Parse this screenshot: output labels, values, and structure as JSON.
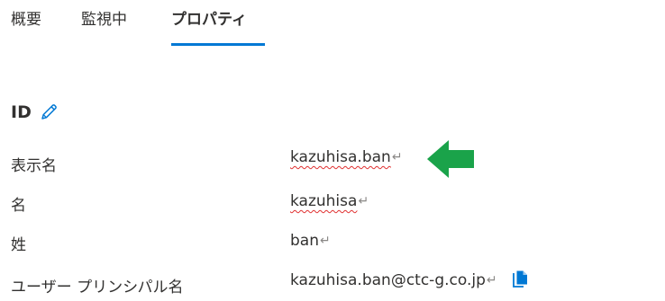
{
  "tabs": [
    {
      "label": "概要"
    },
    {
      "label": "監視中"
    },
    {
      "label": "プロパティ"
    }
  ],
  "active_tab_index": 2,
  "section": {
    "title": "ID",
    "edit_icon": "pencil-icon"
  },
  "fields": [
    {
      "label": "表示名",
      "value": "kazuhisa.ban",
      "return_mark": "↵"
    },
    {
      "label": "名",
      "value": "kazuhisa",
      "return_mark": "↵"
    },
    {
      "label": "姓",
      "value": "ban",
      "return_mark": "↵"
    },
    {
      "label": "ユーザー プリンシパル名",
      "value": "kazuhisa.ban@ctc-g.co.jp",
      "return_mark": "↵",
      "copy_icon": "copy-icon"
    }
  ],
  "annotation": {
    "arrow_icon": "left-arrow-icon",
    "arrow_color": "#1aa34a"
  },
  "colors": {
    "accent": "#0078d4",
    "text": "#323130",
    "spellcheck": "#e03030"
  }
}
